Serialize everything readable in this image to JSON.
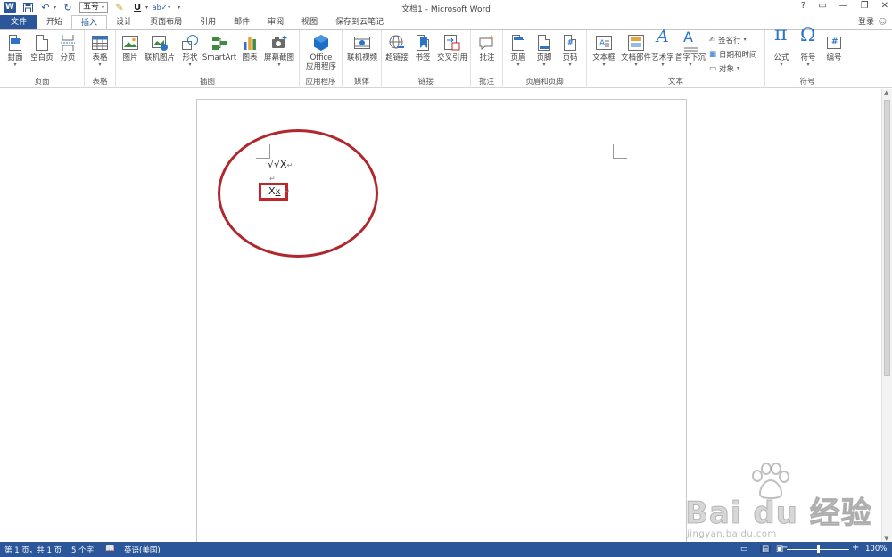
{
  "window": {
    "title": "文档1 - Microsoft Word",
    "font_size_value": "五号",
    "controls": [
      "?",
      "▭",
      "—",
      "❐",
      "✕"
    ]
  },
  "tabs": [
    {
      "label": "文件"
    },
    {
      "label": "开始"
    },
    {
      "label": "插入"
    },
    {
      "label": "设计"
    },
    {
      "label": "页面布局"
    },
    {
      "label": "引用"
    },
    {
      "label": "邮件"
    },
    {
      "label": "审阅"
    },
    {
      "label": "视图"
    },
    {
      "label": "保存到云笔记"
    }
  ],
  "active_tab": "插入",
  "login_label": "登录",
  "ribbon": {
    "groups": {
      "pages": "页面",
      "tables": "表格",
      "illustrations": "插图",
      "apps": "应用程序",
      "media": "媒体",
      "links": "链接",
      "comments": "批注",
      "header_footer": "页眉和页脚",
      "text": "文本",
      "symbols": "符号"
    },
    "buttons": {
      "cover": "封面",
      "blank_page": "空白页",
      "page_break": "分页",
      "table": "表格",
      "picture": "图片",
      "online_picture": "联机图片",
      "shapes": "形状",
      "smartart": "SmartArt",
      "chart": "图表",
      "screenshot": "屏幕截图",
      "office_apps_1": "Office",
      "office_apps_2": "应用程序",
      "online_video": "联机视频",
      "hyperlink": "超链接",
      "bookmark": "书签",
      "cross_ref": "交叉引用",
      "comment": "批注",
      "header": "页眉",
      "footer": "页脚",
      "page_number": "页码",
      "textbox": "文本框",
      "quick_parts": "文档部件",
      "wordart": "艺术字",
      "dropcap": "首字下沉",
      "signature_line": "签名行",
      "date_time": "日期和时间",
      "object": "对象",
      "equation": "公式",
      "symbol": "符号",
      "number": "编号"
    }
  },
  "document": {
    "line1": "√√X",
    "xx_main": "X",
    "xx_sub": "x",
    "pilcrow": "↵"
  },
  "statusbar": {
    "page": "第 1 页，共 1 页",
    "words": "5 个字",
    "language": "英语(美国)",
    "zoom": "100%"
  },
  "watermark": {
    "logo": "Bai du 经验",
    "url": "jingyan.baidu.com"
  },
  "colors": {
    "word_blue": "#2b579a",
    "annotation_red": "#c0272d"
  }
}
